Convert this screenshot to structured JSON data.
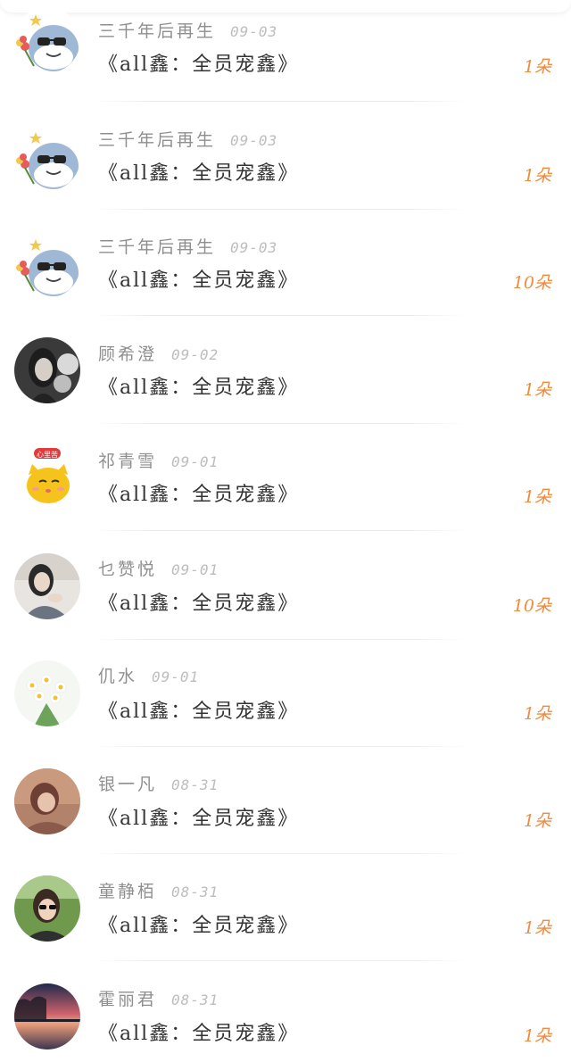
{
  "colors": {
    "gift_accent": "#f08a3e",
    "name_text": "#8f8f8f",
    "date_text": "#bdbdbd",
    "title_text": "#333333"
  },
  "records": [
    {
      "name": "三千年后再生",
      "date": "09-03",
      "title": "《all鑫：全员宠鑫》",
      "gift": "1朵",
      "avatar": "shark-sunglasses-flower-avatar"
    },
    {
      "name": "三千年后再生",
      "date": "09-03",
      "title": "《all鑫：全员宠鑫》",
      "gift": "1朵",
      "avatar": "shark-sunglasses-flower-avatar"
    },
    {
      "name": "三千年后再生",
      "date": "09-03",
      "title": "《all鑫：全员宠鑫》",
      "gift": "10朵",
      "avatar": "shark-sunglasses-flower-avatar"
    },
    {
      "name": "顾希澄",
      "date": "09-02",
      "title": "《all鑫：全员宠鑫》",
      "gift": "1朵",
      "avatar": "dark-anime-girl-avatar"
    },
    {
      "name": "祁青雪",
      "date": "09-01",
      "title": "《all鑫：全员宠鑫》",
      "gift": "1朵",
      "avatar": "yellow-cat-avatar"
    },
    {
      "name": "乜赞悦",
      "date": "09-01",
      "title": "《all鑫：全员宠鑫》",
      "gift": "10朵",
      "avatar": "girl-portrait-avatar"
    },
    {
      "name": "仉水",
      "date": "09-01",
      "title": "《all鑫：全员宠鑫》",
      "gift": "1朵",
      "avatar": "daisies-avatar"
    },
    {
      "name": "银一凡",
      "date": "08-31",
      "title": "《all鑫：全员宠鑫》",
      "gift": "1朵",
      "avatar": "warm-portrait-avatar"
    },
    {
      "name": "童静栢",
      "date": "08-31",
      "title": "《all鑫：全员宠鑫》",
      "gift": "1朵",
      "avatar": "sunglasses-girl-avatar"
    },
    {
      "name": "霍丽君",
      "date": "08-31",
      "title": "《all鑫：全员宠鑫》",
      "gift": "1朵",
      "avatar": "sunset-lake-avatar"
    }
  ],
  "cat_avatar_label": "心里苦"
}
